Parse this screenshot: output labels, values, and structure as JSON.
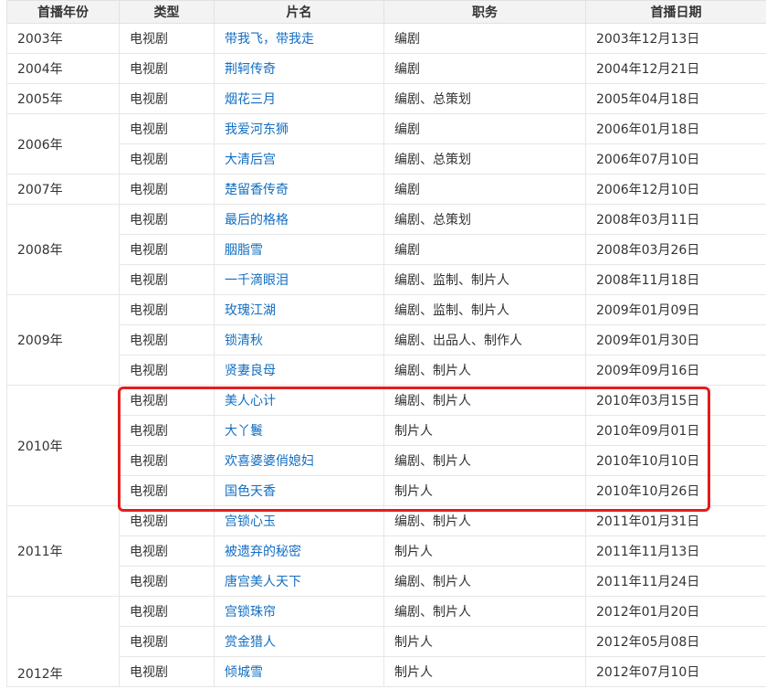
{
  "table": {
    "headers": [
      "首播年份",
      "类型",
      "片名",
      "职务",
      "首播日期"
    ],
    "groups": [
      {
        "year": "2003年",
        "rows": [
          {
            "type": "电视剧",
            "title": "带我飞，带我走",
            "role": "编剧",
            "date": "2003年12月13日"
          }
        ]
      },
      {
        "year": "2004年",
        "rows": [
          {
            "type": "电视剧",
            "title": "荆轲传奇",
            "role": "编剧",
            "date": "2004年12月21日"
          }
        ]
      },
      {
        "year": "2005年",
        "rows": [
          {
            "type": "电视剧",
            "title": "烟花三月",
            "role": "编剧、总策划",
            "date": "2005年04月18日"
          }
        ]
      },
      {
        "year": "2006年",
        "rows": [
          {
            "type": "电视剧",
            "title": "我爱河东狮",
            "role": "编剧",
            "date": "2006年01月18日"
          },
          {
            "type": "电视剧",
            "title": "大清后宫",
            "role": "编剧、总策划",
            "date": "2006年07月10日"
          }
        ]
      },
      {
        "year": "2007年",
        "rows": [
          {
            "type": "电视剧",
            "title": "楚留香传奇",
            "role": "编剧",
            "date": "2006年12月10日"
          }
        ]
      },
      {
        "year": "2008年",
        "rows": [
          {
            "type": "电视剧",
            "title": "最后的格格",
            "role": "编剧、总策划",
            "date": "2008年03月11日"
          },
          {
            "type": "电视剧",
            "title": "胭脂雪",
            "role": "编剧",
            "date": "2008年03月26日"
          },
          {
            "type": "电视剧",
            "title": "一千滴眼泪",
            "role": "编剧、监制、制片人",
            "date": "2008年11月18日"
          }
        ]
      },
      {
        "year": "2009年",
        "rows": [
          {
            "type": "电视剧",
            "title": "玫瑰江湖",
            "role": "编剧、监制、制片人",
            "date": "2009年01月09日"
          },
          {
            "type": "电视剧",
            "title": "锁清秋",
            "role": "编剧、出品人、制作人",
            "date": "2009年01月30日"
          },
          {
            "type": "电视剧",
            "title": "贤妻良母",
            "role": "编剧、制片人",
            "date": "2009年09月16日"
          }
        ]
      },
      {
        "year": "2010年",
        "rows": [
          {
            "type": "电视剧",
            "title": "美人心计",
            "role": "编剧、制片人",
            "date": "2010年03月15日"
          },
          {
            "type": "电视剧",
            "title": "大丫鬟",
            "role": "制片人",
            "date": "2010年09月01日"
          },
          {
            "type": "电视剧",
            "title": "欢喜婆婆俏媳妇",
            "role": "编剧、制片人",
            "date": "2010年10月10日"
          },
          {
            "type": "电视剧",
            "title": "国色天香",
            "role": "制片人",
            "date": "2010年10月26日"
          }
        ]
      },
      {
        "year": "2011年",
        "rows": [
          {
            "type": "电视剧",
            "title": "宫锁心玉",
            "role": "编剧、制片人",
            "date": "2011年01月31日"
          },
          {
            "type": "电视剧",
            "title": "被遗弃的秘密",
            "role": "制片人",
            "date": "2011年11月13日"
          },
          {
            "type": "电视剧",
            "title": "唐宫美人天下",
            "role": "编剧、制片人",
            "date": "2011年11月24日"
          }
        ]
      },
      {
        "year": "2012年",
        "year_align": "bottom",
        "rows": [
          {
            "type": "电视剧",
            "title": "宫锁珠帘",
            "role": "编剧、制片人",
            "date": "2012年01月20日"
          },
          {
            "type": "电视剧",
            "title": "赏金猎人",
            "role": "制片人",
            "date": "2012年05月08日"
          },
          {
            "type": "电视剧",
            "title": "倾城雪",
            "role": "制片人",
            "date": "2012年07月10日"
          }
        ]
      }
    ]
  },
  "highlight": {
    "color": "#e21e1e",
    "year": "2010年"
  },
  "colors": {
    "link": "#136ec2",
    "header_bg": "#f3f3f3",
    "border": "#e6e6e6",
    "text": "#333333"
  }
}
